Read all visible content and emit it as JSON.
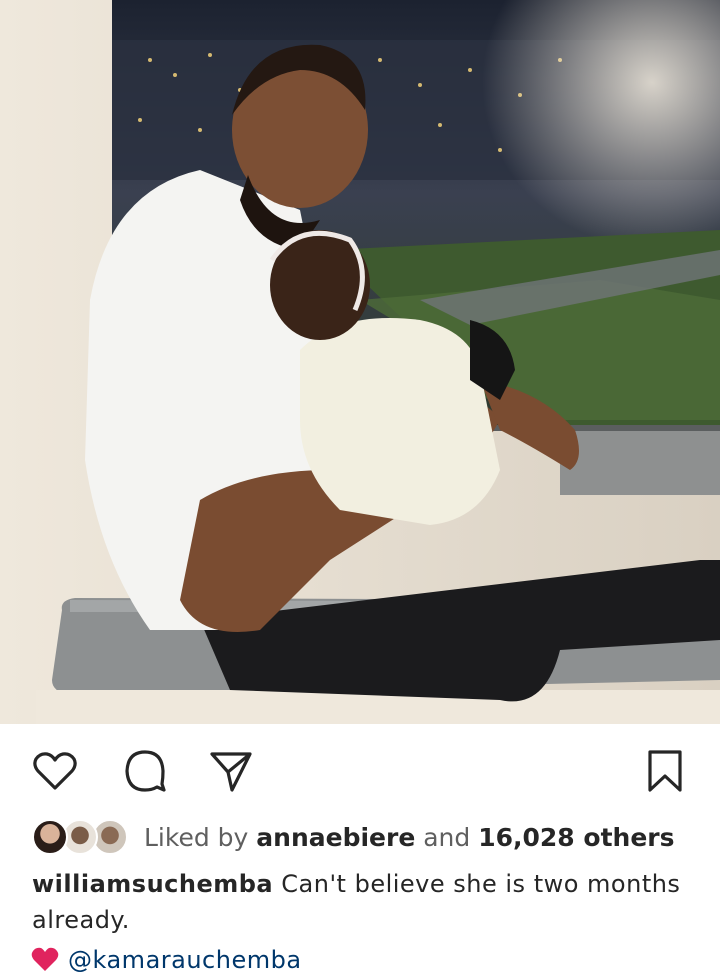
{
  "post": {
    "image_alt": "",
    "actions": {
      "like_icon": "heart-outline-icon",
      "comment_icon": "comment-bubble-icon",
      "share_icon": "paper-plane-icon",
      "save_icon": "bookmark-icon"
    },
    "likes": {
      "prefix": "Liked by",
      "liker": "annaebiere",
      "joiner": "and",
      "others": "16,028 others"
    },
    "caption": {
      "username": "williamsuchemba",
      "text": "Can't believe she is two months already."
    },
    "mention": {
      "emoji": "red-heart-icon",
      "handle": "@kamarauchemba"
    }
  },
  "colors": {
    "text": "#262626",
    "muted": "#5f5f5f",
    "mention": "#00376b",
    "heart": "#e0245e"
  }
}
